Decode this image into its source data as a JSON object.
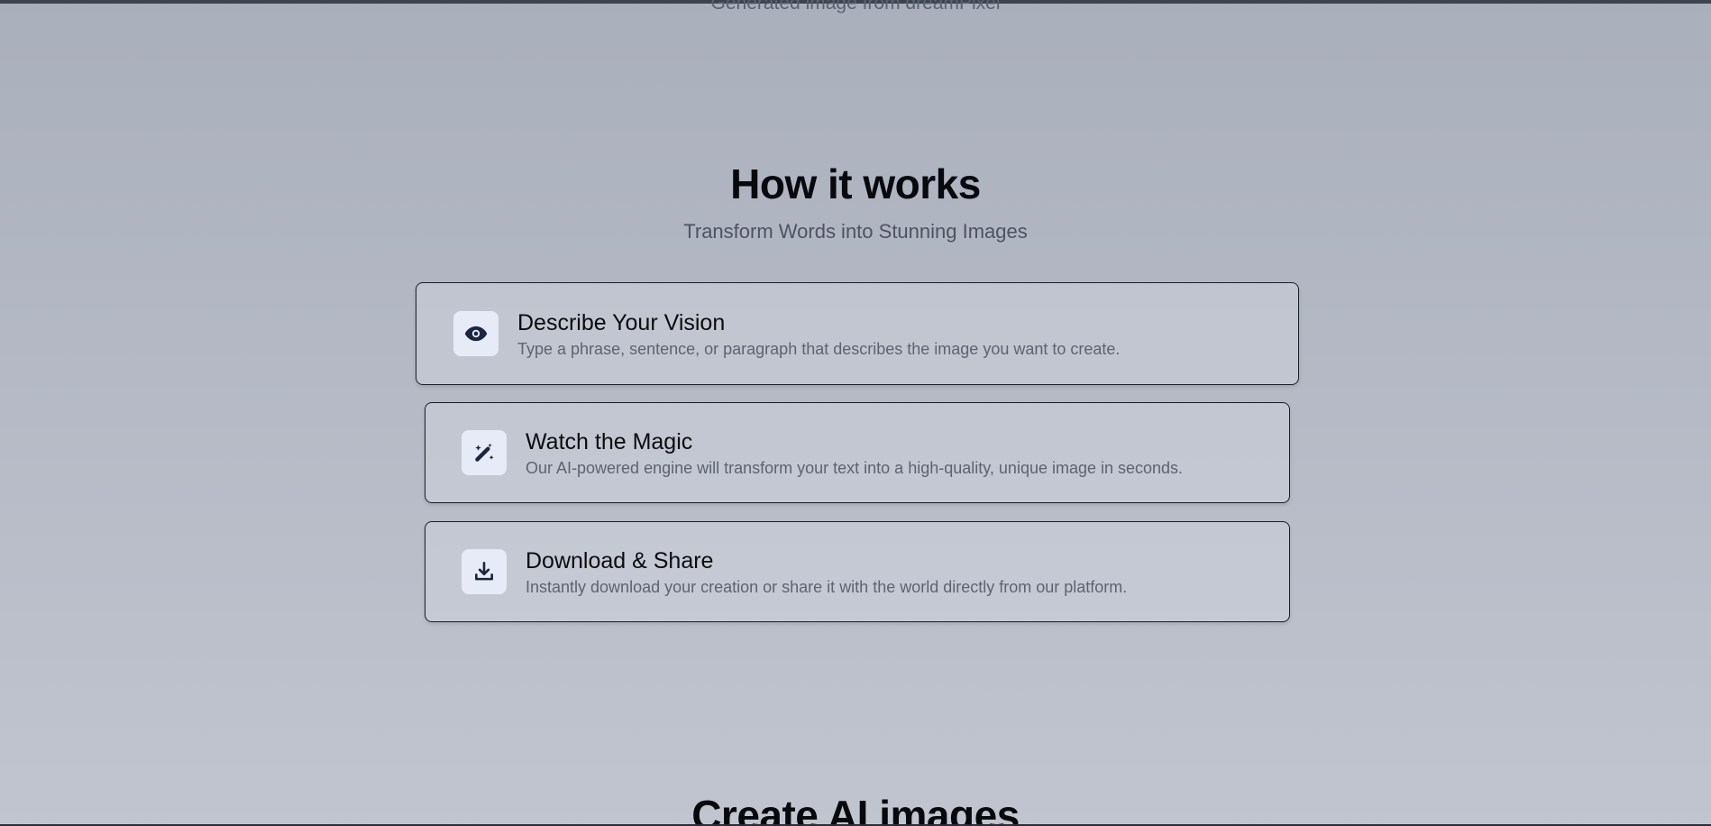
{
  "hero": {
    "caption": "Generated image from dreamPixel"
  },
  "how_it_works": {
    "title": "How it works",
    "subtitle": "Transform Words into Stunning Images",
    "steps": [
      {
        "icon": "eye-icon",
        "title": "Describe Your Vision",
        "description": "Type a phrase, sentence, or paragraph that describes the image you want to create."
      },
      {
        "icon": "magic-wand-icon",
        "title": "Watch the Magic",
        "description": "Our AI-powered engine will transform your text into a high-quality, unique image in seconds."
      },
      {
        "icon": "download-icon",
        "title": "Download & Share",
        "description": "Instantly download your creation or share it with the world directly from our platform."
      }
    ]
  },
  "next_section": {
    "title": "Create AI images"
  },
  "colors": {
    "icon_color": "#1b2440",
    "icon_background": "#e7ebf7",
    "card_border": "#1a1d24"
  }
}
